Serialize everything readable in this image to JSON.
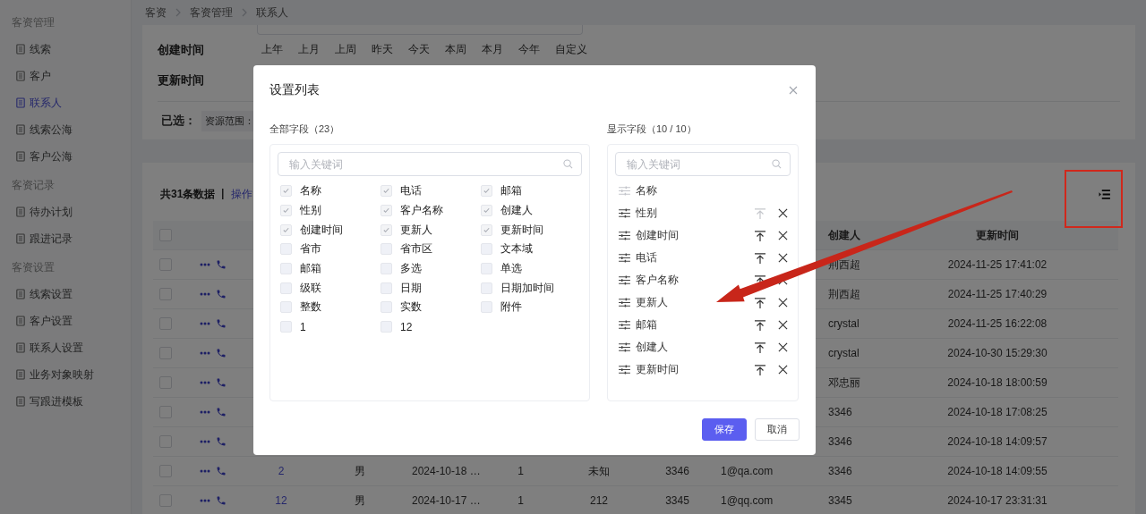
{
  "sidebar": {
    "groups": [
      {
        "title": "客资管理",
        "items": [
          {
            "label": "线索",
            "selected": false
          },
          {
            "label": "客户",
            "selected": false
          },
          {
            "label": "联系人",
            "selected": true
          },
          {
            "label": "线索公海",
            "selected": false
          },
          {
            "label": "客户公海",
            "selected": false
          }
        ]
      },
      {
        "title": "客资记录",
        "items": [
          {
            "label": "待办计划",
            "selected": false
          },
          {
            "label": "跟进记录",
            "selected": false
          }
        ]
      },
      {
        "title": "客资设置",
        "items": [
          {
            "label": "线索设置",
            "selected": false
          },
          {
            "label": "客户设置",
            "selected": false
          },
          {
            "label": "联系人设置",
            "selected": false
          },
          {
            "label": "业务对象映射",
            "selected": false
          },
          {
            "label": "写跟进模板",
            "selected": false
          }
        ]
      }
    ]
  },
  "breadcrumb": [
    "客资",
    "客资管理",
    "联系人"
  ],
  "filters": [
    {
      "label": "创建时间",
      "options": [
        "上年",
        "上月",
        "上周",
        "昨天",
        "今天",
        "本周",
        "本月",
        "今年",
        "自定义"
      ]
    },
    {
      "label": "更新时间"
    }
  ],
  "selected_filters": {
    "label": "已选：",
    "chips": [
      "资源范围："
    ]
  },
  "table": {
    "summary": "共31条数据",
    "bulk_action": "操作",
    "all_selected": false,
    "headers": {
      "creator": "创建人",
      "updated_at": "更新时间"
    },
    "rows": [
      {
        "selected": false,
        "cells": {
          "creator": "荆西超",
          "updated_at": "2024-11-25 17:41:02"
        }
      },
      {
        "selected": false,
        "cells": {
          "creator": "荆西超",
          "updated_at": "2024-11-25 17:40:29"
        }
      },
      {
        "selected": false,
        "cells": {
          "creator": "crystal",
          "updated_at": "2024-11-25 16:22:08"
        }
      },
      {
        "selected": false,
        "cells": {
          "creator": "crystal",
          "updated_at": "2024-10-30 15:29:30"
        }
      },
      {
        "selected": false,
        "cells": {
          "creator": "邓忠丽",
          "updated_at": "2024-10-18 18:00:59"
        }
      },
      {
        "selected": false,
        "cells": {
          "creator": "3346",
          "updated_at": "2024-10-18 17:08:25"
        }
      },
      {
        "selected": false,
        "cells": {
          "creator": "3346",
          "updated_at": "2024-10-18 14:09:57"
        }
      },
      {
        "selected": false,
        "cells": {
          "column_3": "2",
          "column_4": "男",
          "column_5": "2024-10-18 …",
          "column_6": "1",
          "column_7": "未知",
          "column_8": "3346",
          "column_9": "1@qa.com",
          "creator": "3346",
          "updated_at": "2024-10-18 14:09:55"
        }
      },
      {
        "selected": false,
        "cells": {
          "column_3": "12",
          "column_4": "男",
          "column_5": "2024-10-17 …",
          "column_6": "1",
          "column_7": "212",
          "column_8": "3345",
          "column_9": "1@qq.com",
          "creator": "3345",
          "updated_at": "2024-10-17 23:31:31"
        }
      }
    ]
  },
  "modal": {
    "title": "设置列表",
    "all_fields": {
      "label": "全部字段（23）",
      "placeholder": "输入关键词",
      "items": [
        {
          "label": "名称",
          "checked": true
        },
        {
          "label": "电话",
          "checked": true
        },
        {
          "label": "邮箱",
          "checked": true
        },
        {
          "label": "性别",
          "checked": true
        },
        {
          "label": "客户名称",
          "checked": true
        },
        {
          "label": "创建人",
          "checked": true
        },
        {
          "label": "创建时间",
          "checked": true
        },
        {
          "label": "更新人",
          "checked": true
        },
        {
          "label": "更新时间",
          "checked": true
        },
        {
          "label": "省市",
          "checked": false
        },
        {
          "label": "省市区",
          "checked": false
        },
        {
          "label": "文本域",
          "checked": false
        },
        {
          "label": "邮箱",
          "checked": false
        },
        {
          "label": "多选",
          "checked": false
        },
        {
          "label": "单选",
          "checked": false
        },
        {
          "label": "级联",
          "checked": false
        },
        {
          "label": "日期",
          "checked": false
        },
        {
          "label": "日期加时间",
          "checked": false
        },
        {
          "label": "整数",
          "checked": false
        },
        {
          "label": "实数",
          "checked": false
        },
        {
          "label": "附件",
          "checked": false
        },
        {
          "label": "1",
          "checked": false
        },
        {
          "label": "12",
          "checked": false
        }
      ]
    },
    "shown_fields": {
      "label": "显示字段（10 / 10）",
      "placeholder": "输入关键词",
      "items": [
        {
          "label": "名称",
          "locked": true
        },
        {
          "label": "性别",
          "locked": false,
          "top_disabled": true
        },
        {
          "label": "创建时间",
          "locked": false,
          "top_disabled": false
        },
        {
          "label": "电话",
          "locked": false,
          "top_disabled": false
        },
        {
          "label": "客户名称",
          "locked": false,
          "top_disabled": false
        },
        {
          "label": "更新人",
          "locked": false,
          "top_disabled": false
        },
        {
          "label": "邮箱",
          "locked": false,
          "top_disabled": false
        },
        {
          "label": "创建人",
          "locked": false,
          "top_disabled": false
        },
        {
          "label": "更新时间",
          "locked": false,
          "top_disabled": false
        }
      ]
    },
    "buttons": [
      {
        "label": "保存",
        "kind": "primary"
      },
      {
        "label": "取消",
        "kind": "default"
      }
    ]
  }
}
